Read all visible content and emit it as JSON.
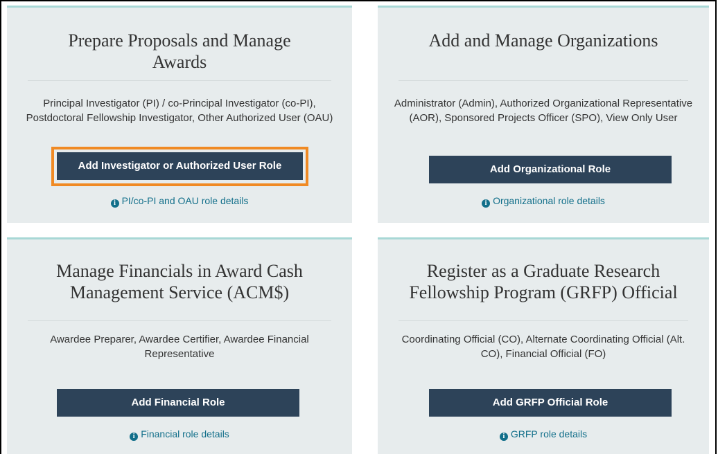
{
  "cards": [
    {
      "title": "Prepare Proposals and Manage Awards",
      "roles": "Principal Investigator (PI) / co-Principal Investigator (co-PI), Postdoctoral Fellowship Investigator, Other Authorized User (OAU)",
      "button": "Add Investigator or Authorized User Role",
      "details": "PI/co-PI and OAU role details"
    },
    {
      "title": "Add and Manage Organizations",
      "roles": "Administrator (Admin), Authorized Organizational Representative (AOR), Sponsored Projects Officer (SPO), View Only User",
      "button": "Add Organizational Role",
      "details": "Organizational role details"
    },
    {
      "title": "Manage Financials in Award Cash Management Service (ACM$)",
      "roles": "Awardee Preparer, Awardee Certifier, Awardee Financial Representative",
      "button": "Add Financial Role",
      "details": "Financial role details"
    },
    {
      "title": "Register as a Graduate Research Fellowship Program (GRFP) Official",
      "roles": "Coordinating Official (CO), Alternate Coordinating Official (Alt. CO), Financial Official (FO)",
      "button": "Add GRFP Official Role",
      "details": "GRFP role details"
    }
  ],
  "icons": {
    "info": "info-circle-icon"
  },
  "colors": {
    "button": "#2d4359",
    "highlight": "#f08a24",
    "link": "#126f8a",
    "card": "#e7eced"
  }
}
